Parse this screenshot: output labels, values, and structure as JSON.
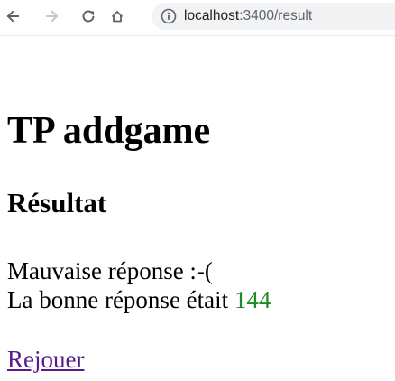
{
  "browser": {
    "url_host": "localhost",
    "url_path": ":3400/result",
    "colors": {
      "toolbar_icon": "#5f6368",
      "omnibox_bg": "#f1f3f4"
    },
    "icons": [
      "back-arrow-icon",
      "forward-arrow-icon",
      "reload-icon",
      "home-icon",
      "info-icon"
    ]
  },
  "page": {
    "title": "TP addgame",
    "heading": "Résultat",
    "wrong_answer_text": "Mauvaise réponse :-(",
    "correct_answer_prefix": "La bonne réponse était",
    "correct_answer_value": "144",
    "replay_link": "Rejouer",
    "colors": {
      "answer_value": "#1f8a2a",
      "visited_link": "#551a8b"
    }
  }
}
